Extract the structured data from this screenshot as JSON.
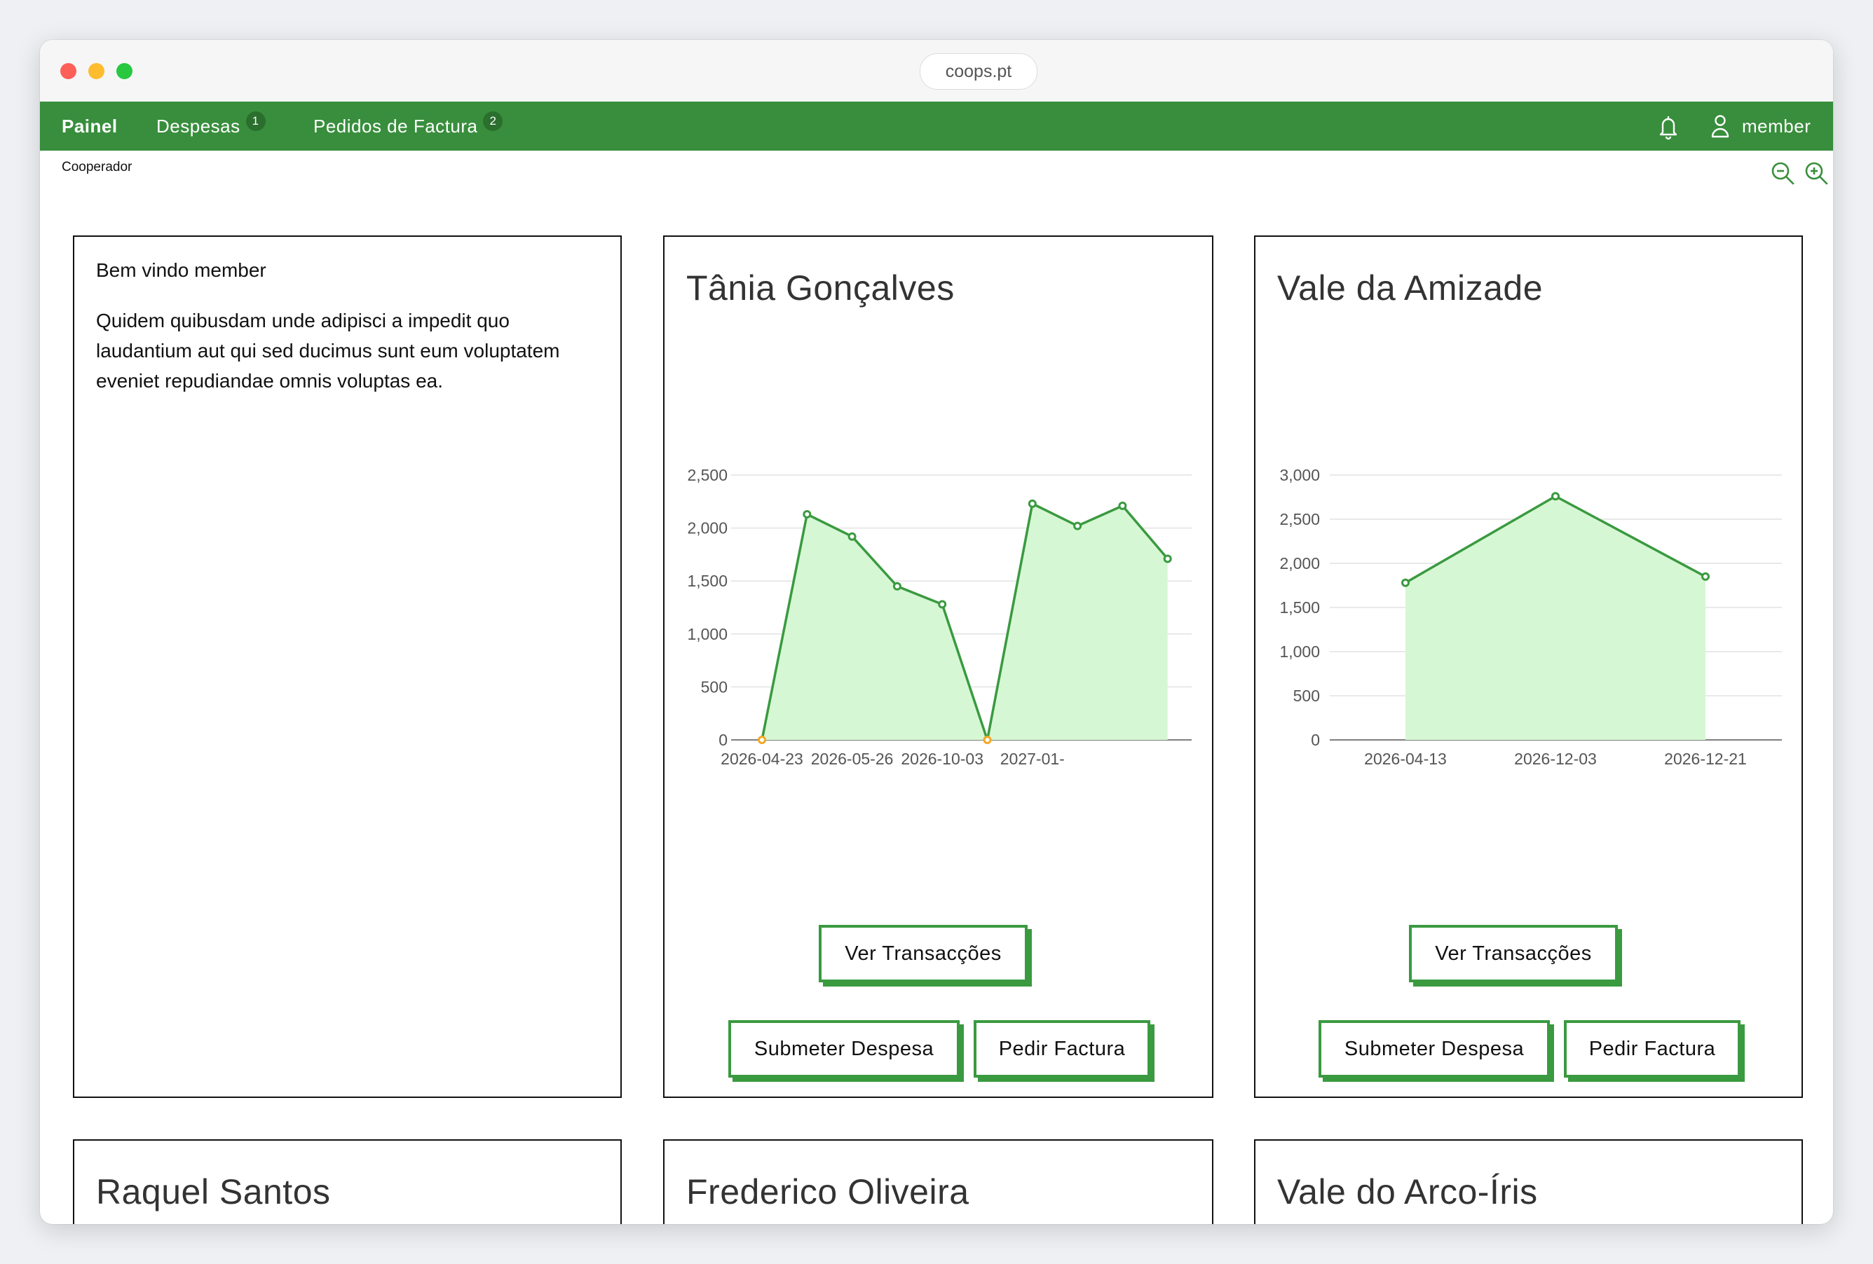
{
  "browser": {
    "url": "coops.pt"
  },
  "nav": {
    "items": [
      {
        "label": "Painel",
        "badge": ""
      },
      {
        "label": "Despesas",
        "badge": "1"
      },
      {
        "label": "Pedidos de Factura",
        "badge": "2"
      }
    ],
    "user": "member"
  },
  "subheader": {
    "role": "Cooperador"
  },
  "welcome": {
    "title": "Bem vindo member",
    "text": "Quidem quibusdam unde adipisci a impedit quo laudantium aut qui sed ducimus sunt eum voluptatem eveniet repudiandae omnis voluptas ea."
  },
  "cards": [
    {
      "title": "Tânia Gonçalves",
      "btn_transactions": "Ver Transacções",
      "btn_expense": "Submeter Despesa",
      "btn_invoice": "Pedir Factura"
    },
    {
      "title": "Vale da Amizade",
      "btn_transactions": "Ver Transacções",
      "btn_expense": "Submeter Despesa",
      "btn_invoice": "Pedir Factura"
    },
    {
      "title": "Raquel Santos"
    },
    {
      "title": "Frederico Oliveira"
    },
    {
      "title": "Vale do Arco-Íris"
    }
  ],
  "colors": {
    "brand": "#388e3c",
    "line": "#3a9a40",
    "fill": "#d6f7d4",
    "zero_point": "#f5a623"
  },
  "chart_data": [
    {
      "type": "area",
      "ylim": [
        0,
        2500
      ],
      "yticks": [
        "0",
        "500",
        "1,000",
        "1,500",
        "2,000",
        "2,500"
      ],
      "xtick_labels": [
        "2026-04-23",
        "2026-05-26",
        "2026-10-03",
        "2027-01-"
      ],
      "series": [
        {
          "values": [
            0,
            2130,
            1920,
            1450,
            1280,
            0,
            2230,
            2020,
            2210,
            1710
          ]
        }
      ]
    },
    {
      "type": "area",
      "ylim": [
        0,
        3000
      ],
      "yticks": [
        "0",
        "500",
        "1,000",
        "1,500",
        "2,000",
        "2,500",
        "3,000"
      ],
      "categories": [
        "2026-04-13",
        "2026-12-03",
        "2026-12-21"
      ],
      "series": [
        {
          "values": [
            1780,
            2760,
            1850
          ]
        }
      ]
    }
  ]
}
